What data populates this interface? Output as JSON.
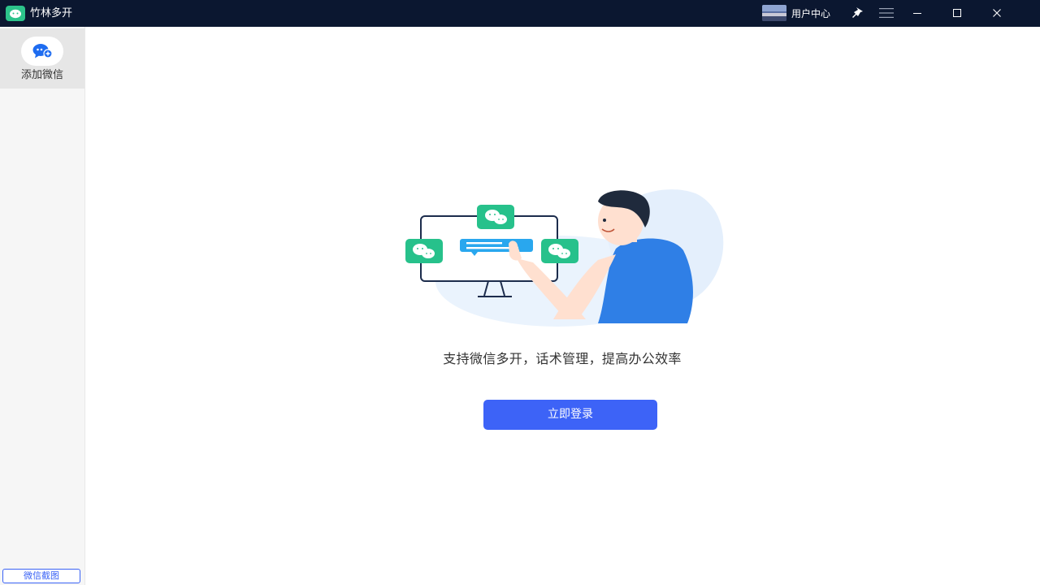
{
  "app": {
    "title": "竹林多开",
    "logo_icon": "wechat-logo-icon",
    "accent": "#3d63f7",
    "titlebar_color": "#0b1730",
    "brand_green": "#2cc38b"
  },
  "header": {
    "user_center_label": "用户中心",
    "pin_icon": "pin-icon",
    "menu_icon": "menu-icon",
    "minimize_icon": "minimize-icon",
    "maximize_icon": "maximize-icon",
    "close_icon": "close-icon"
  },
  "sidebar": {
    "add_wechat_label": "添加微信",
    "add_wechat_icon": "add-chat-icon",
    "screenshot_label": "微信截图"
  },
  "main": {
    "tagline": "支持微信多开，话术管理，提高办公效率",
    "login_label": "立即登录"
  }
}
